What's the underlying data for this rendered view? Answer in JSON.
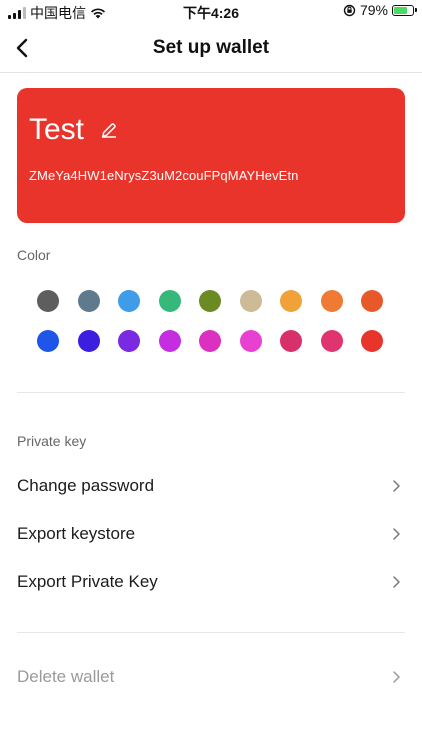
{
  "status_bar": {
    "carrier": "中国电信",
    "time": "下午4:26",
    "battery": "79%",
    "battery_level": 0.79
  },
  "nav": {
    "title": "Set up wallet",
    "back_icon": "chevron-left-icon"
  },
  "wallet": {
    "name": "Test",
    "address": "ZMeYa4HW1eNrysZ3uM2couFPqMAYHevEtn",
    "card_color": "#e8342a"
  },
  "color_section": {
    "label": "Color",
    "swatches_row1": [
      "#5e5e5e",
      "#5e7a8c",
      "#3f9ce8",
      "#36b87a",
      "#6b8a24",
      "#cdbb98",
      "#f0a13a",
      "#ee7a33",
      "#e8592a"
    ],
    "swatches_row2": [
      "#1f55e8",
      "#3b1ee0",
      "#7a2ae0",
      "#c42ee0",
      "#dc30c0",
      "#e840d0",
      "#d8306a",
      "#e03470",
      "#e8342a"
    ]
  },
  "private_key_section": {
    "label": "Private key",
    "items": [
      {
        "label": "Change password"
      },
      {
        "label": "Export keystore"
      },
      {
        "label": "Export Private Key"
      }
    ]
  },
  "danger_section": {
    "delete_label": "Delete wallet"
  }
}
